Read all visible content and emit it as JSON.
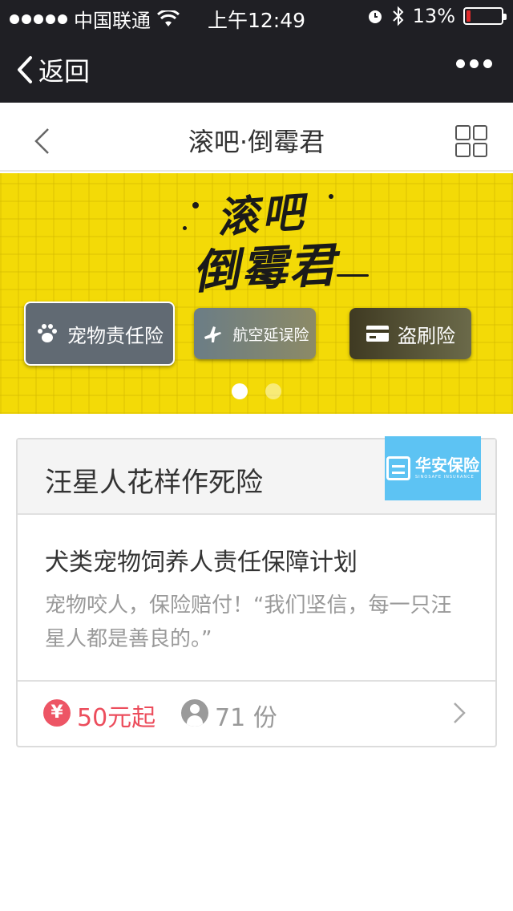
{
  "status_bar": {
    "carrier": "中国联通",
    "time": "上午12:49",
    "battery": "13%",
    "battery_level": 0.13,
    "icons": [
      "signal-dots-icon",
      "wifi-icon",
      "alarm-icon",
      "bluetooth-icon",
      "battery-icon"
    ]
  },
  "wx_nav": {
    "back_label": "返回",
    "more_icon": "more-dots-icon"
  },
  "header": {
    "title": "滚吧·倒霉君",
    "back_icon": "chevron-left-icon",
    "menu_icon": "grid-icon"
  },
  "banner": {
    "logo_line1": "滚吧",
    "logo_line2": "倒霉君",
    "buttons": [
      {
        "label": "宠物责任险",
        "icon": "paw-icon"
      },
      {
        "label": "航空延误险",
        "icon": "airplane-icon"
      },
      {
        "label": "盗刷险",
        "icon": "card-icon"
      }
    ],
    "pager_count": 2,
    "pager_active": 1,
    "background_color": "#f3da07"
  },
  "product": {
    "title": "汪星人花样作死险",
    "brand_name": "华安保险",
    "brand_en": "SINOSAFE INSURANCE",
    "brand_color": "#5dc3f3",
    "subtitle": "犬类宠物饲养人责任保障计划",
    "description": "宠物咬人，保险赔付！“我们坚信，每一只汪星人都是善良的。”",
    "price_icon": "¥",
    "price": "50元起",
    "count": "71 份",
    "price_color": "#ec4d5c"
  }
}
